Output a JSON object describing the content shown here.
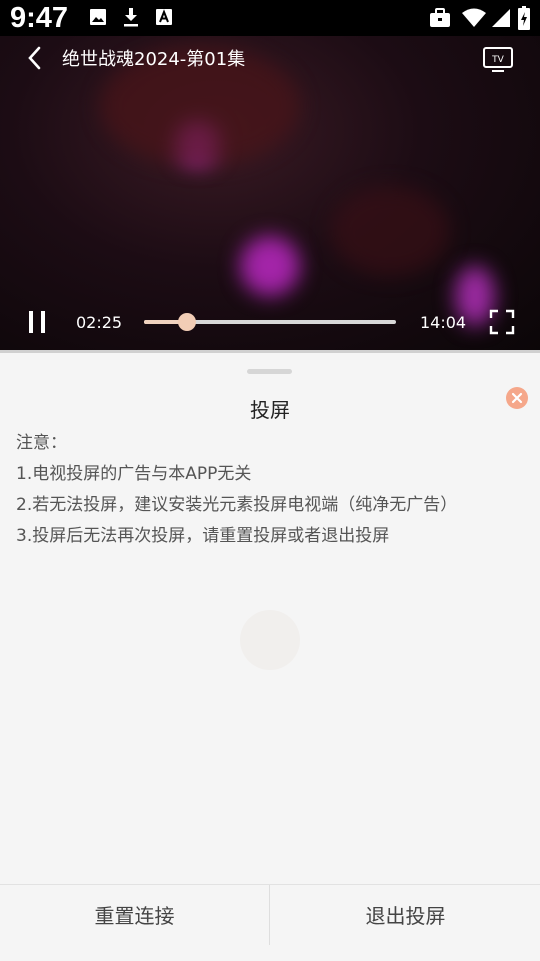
{
  "status_bar": {
    "time": "9:47",
    "left_icons": [
      "image-icon",
      "download-icon",
      "font-icon"
    ],
    "right_icons": [
      "briefcase-icon",
      "wifi-icon",
      "signal-icon",
      "battery-icon"
    ]
  },
  "player": {
    "title": "绝世战魂2024-第01集",
    "current_time": "02:25",
    "total_time": "14:04",
    "progress": 0.172,
    "accent_color": "#f2cdb6",
    "icons": [
      "back-icon",
      "tv-icon",
      "pause-icon",
      "fullscreen-icon"
    ]
  },
  "cast_panel": {
    "title": "投屏",
    "notes_heading": "注意：",
    "notes": [
      "1.电视投屏的广告与本APP无关",
      "2.若无法投屏，建议安装光元素投屏电视端（纯净无广告）",
      "3.投屏后无法再次投屏，请重置投屏或者退出投屏"
    ],
    "close_color": "#f5a78a"
  },
  "buttons": {
    "reset": "重置连接",
    "exit": "退出投屏"
  }
}
